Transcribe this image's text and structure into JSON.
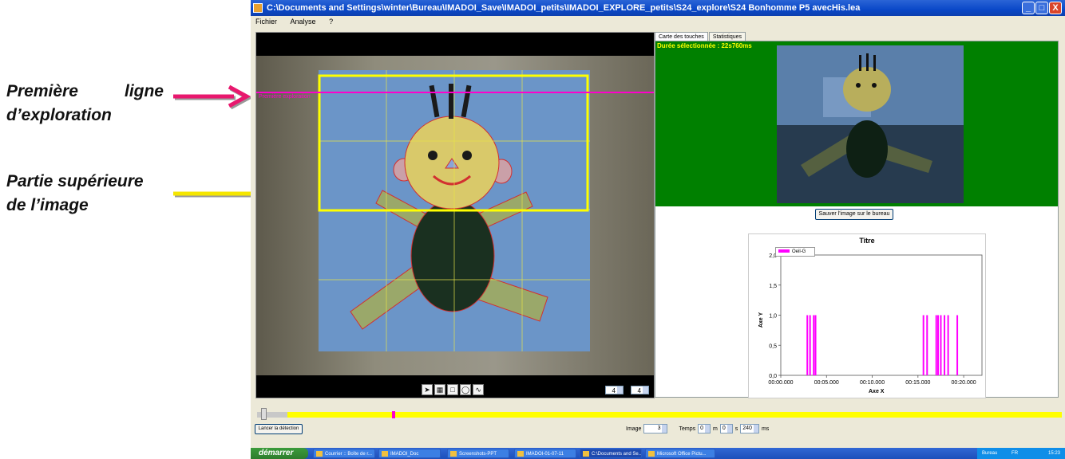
{
  "annotations": {
    "premiere_line1_word1": "Première",
    "premiere_line1_word2": "ligne",
    "premiere_line2": "d’exploration",
    "partie_line1": "Partie supérieure",
    "partie_line2": "de l’image",
    "pink_color": "#e8186e",
    "yellow_color": "#f5e600"
  },
  "window": {
    "title": "C:\\Documents and Settings\\winter\\Bureau\\IMADOI_Save\\IMADOI_petits\\IMADOI_EXPLORE_petits\\S24_explore\\S24 Bonhomme P5 avecHis.lea",
    "menu": [
      "Fichier",
      "Analyse",
      "?"
    ],
    "minimize": "_",
    "maximize": "□",
    "close": "X"
  },
  "left_panel": {
    "exploration_label": "Première exploration",
    "line_color": "#ff00cc",
    "grid_x": "4",
    "grid_y": "4",
    "times": "x",
    "tools": [
      "arrow-icon",
      "grid-icon",
      "rectangle-icon",
      "ellipse-icon",
      "freehand-icon"
    ]
  },
  "right_panel": {
    "tabs": [
      "Carte des touches",
      "Statistiques"
    ],
    "duration": "Durée sélectionnée : 22s760ms",
    "save_button": "Sauver l'image sur le bureau"
  },
  "chart_data": {
    "type": "bar",
    "title": "Titre",
    "xlabel": "Axe X",
    "ylabel": "Axe Y",
    "ylim": [
      0,
      2.0
    ],
    "xlim_seconds": [
      0,
      22
    ],
    "x_ticks": [
      "00:00.000",
      "00:05.000",
      "00:10.000",
      "00:15.000",
      "00:20.000"
    ],
    "y_ticks": [
      "0,0",
      "0,5",
      "1,0",
      "1,5",
      "2,0"
    ],
    "legend": "Oeil-G",
    "legend_position": "top-left",
    "color": "#ff00ff",
    "series": [
      {
        "name": "Oeil-G",
        "x_seconds": [
          2.9,
          3.2,
          3.6,
          3.8,
          15.6,
          16.0,
          17.0,
          17.2,
          17.5,
          17.9,
          18.3,
          19.3
        ],
        "values": [
          1,
          1,
          1,
          1,
          1,
          1,
          1,
          1,
          1,
          1,
          1,
          1
        ]
      }
    ]
  },
  "bottom": {
    "lancer": "Lancer la détection",
    "image_label": "Image",
    "image_value": "3",
    "temps_label": "Temps",
    "temps_min": "0",
    "min_unit": "m",
    "temps_sec": "0",
    "sec_unit": "s",
    "temps_ms": "240",
    "ms_unit": "ms",
    "timeline_color": "#ffff00"
  },
  "taskbar": {
    "start": "démarrer",
    "items": [
      "Courrier :: Boîte de r...",
      "IMADOI_Doc",
      "Screenshots-PPT",
      "IMADOI-01-07-11",
      "C:\\Documents and Se...",
      "Microsoft Office Pictu..."
    ],
    "tray_label": "Bureau",
    "tray_lang": "FR",
    "clock": "15:23"
  }
}
